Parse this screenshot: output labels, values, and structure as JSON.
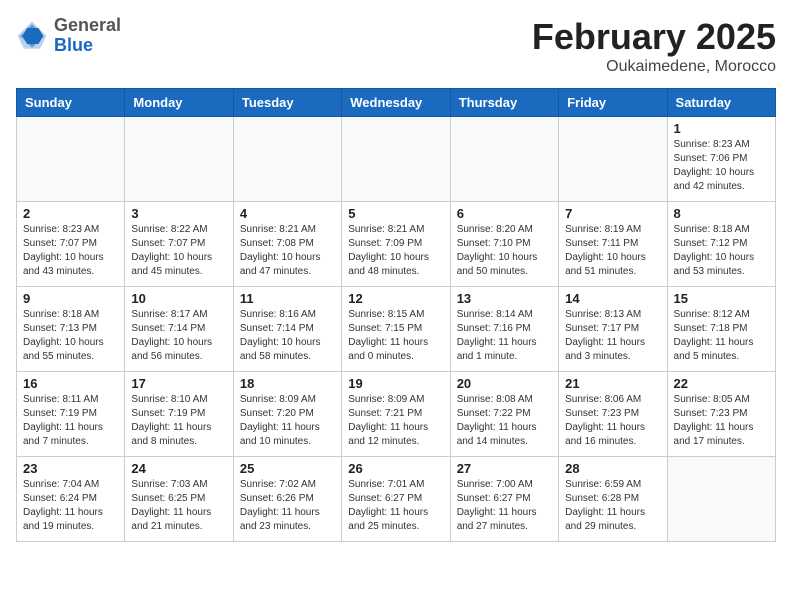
{
  "header": {
    "logo_general": "General",
    "logo_blue": "Blue",
    "month": "February 2025",
    "location": "Oukaimedene, Morocco"
  },
  "days_of_week": [
    "Sunday",
    "Monday",
    "Tuesday",
    "Wednesday",
    "Thursday",
    "Friday",
    "Saturday"
  ],
  "weeks": [
    [
      {
        "day": "",
        "info": ""
      },
      {
        "day": "",
        "info": ""
      },
      {
        "day": "",
        "info": ""
      },
      {
        "day": "",
        "info": ""
      },
      {
        "day": "",
        "info": ""
      },
      {
        "day": "",
        "info": ""
      },
      {
        "day": "1",
        "info": "Sunrise: 8:23 AM\nSunset: 7:06 PM\nDaylight: 10 hours\nand 42 minutes."
      }
    ],
    [
      {
        "day": "2",
        "info": "Sunrise: 8:23 AM\nSunset: 7:07 PM\nDaylight: 10 hours\nand 43 minutes."
      },
      {
        "day": "3",
        "info": "Sunrise: 8:22 AM\nSunset: 7:07 PM\nDaylight: 10 hours\nand 45 minutes."
      },
      {
        "day": "4",
        "info": "Sunrise: 8:21 AM\nSunset: 7:08 PM\nDaylight: 10 hours\nand 47 minutes."
      },
      {
        "day": "5",
        "info": "Sunrise: 8:21 AM\nSunset: 7:09 PM\nDaylight: 10 hours\nand 48 minutes."
      },
      {
        "day": "6",
        "info": "Sunrise: 8:20 AM\nSunset: 7:10 PM\nDaylight: 10 hours\nand 50 minutes."
      },
      {
        "day": "7",
        "info": "Sunrise: 8:19 AM\nSunset: 7:11 PM\nDaylight: 10 hours\nand 51 minutes."
      },
      {
        "day": "8",
        "info": "Sunrise: 8:18 AM\nSunset: 7:12 PM\nDaylight: 10 hours\nand 53 minutes."
      }
    ],
    [
      {
        "day": "9",
        "info": "Sunrise: 8:18 AM\nSunset: 7:13 PM\nDaylight: 10 hours\nand 55 minutes."
      },
      {
        "day": "10",
        "info": "Sunrise: 8:17 AM\nSunset: 7:14 PM\nDaylight: 10 hours\nand 56 minutes."
      },
      {
        "day": "11",
        "info": "Sunrise: 8:16 AM\nSunset: 7:14 PM\nDaylight: 10 hours\nand 58 minutes."
      },
      {
        "day": "12",
        "info": "Sunrise: 8:15 AM\nSunset: 7:15 PM\nDaylight: 11 hours\nand 0 minutes."
      },
      {
        "day": "13",
        "info": "Sunrise: 8:14 AM\nSunset: 7:16 PM\nDaylight: 11 hours\nand 1 minute."
      },
      {
        "day": "14",
        "info": "Sunrise: 8:13 AM\nSunset: 7:17 PM\nDaylight: 11 hours\nand 3 minutes."
      },
      {
        "day": "15",
        "info": "Sunrise: 8:12 AM\nSunset: 7:18 PM\nDaylight: 11 hours\nand 5 minutes."
      }
    ],
    [
      {
        "day": "16",
        "info": "Sunrise: 8:11 AM\nSunset: 7:19 PM\nDaylight: 11 hours\nand 7 minutes."
      },
      {
        "day": "17",
        "info": "Sunrise: 8:10 AM\nSunset: 7:19 PM\nDaylight: 11 hours\nand 8 minutes."
      },
      {
        "day": "18",
        "info": "Sunrise: 8:09 AM\nSunset: 7:20 PM\nDaylight: 11 hours\nand 10 minutes."
      },
      {
        "day": "19",
        "info": "Sunrise: 8:09 AM\nSunset: 7:21 PM\nDaylight: 11 hours\nand 12 minutes."
      },
      {
        "day": "20",
        "info": "Sunrise: 8:08 AM\nSunset: 7:22 PM\nDaylight: 11 hours\nand 14 minutes."
      },
      {
        "day": "21",
        "info": "Sunrise: 8:06 AM\nSunset: 7:23 PM\nDaylight: 11 hours\nand 16 minutes."
      },
      {
        "day": "22",
        "info": "Sunrise: 8:05 AM\nSunset: 7:23 PM\nDaylight: 11 hours\nand 17 minutes."
      }
    ],
    [
      {
        "day": "23",
        "info": "Sunrise: 7:04 AM\nSunset: 6:24 PM\nDaylight: 11 hours\nand 19 minutes."
      },
      {
        "day": "24",
        "info": "Sunrise: 7:03 AM\nSunset: 6:25 PM\nDaylight: 11 hours\nand 21 minutes."
      },
      {
        "day": "25",
        "info": "Sunrise: 7:02 AM\nSunset: 6:26 PM\nDaylight: 11 hours\nand 23 minutes."
      },
      {
        "day": "26",
        "info": "Sunrise: 7:01 AM\nSunset: 6:27 PM\nDaylight: 11 hours\nand 25 minutes."
      },
      {
        "day": "27",
        "info": "Sunrise: 7:00 AM\nSunset: 6:27 PM\nDaylight: 11 hours\nand 27 minutes."
      },
      {
        "day": "28",
        "info": "Sunrise: 6:59 AM\nSunset: 6:28 PM\nDaylight: 11 hours\nand 29 minutes."
      },
      {
        "day": "",
        "info": ""
      }
    ]
  ]
}
